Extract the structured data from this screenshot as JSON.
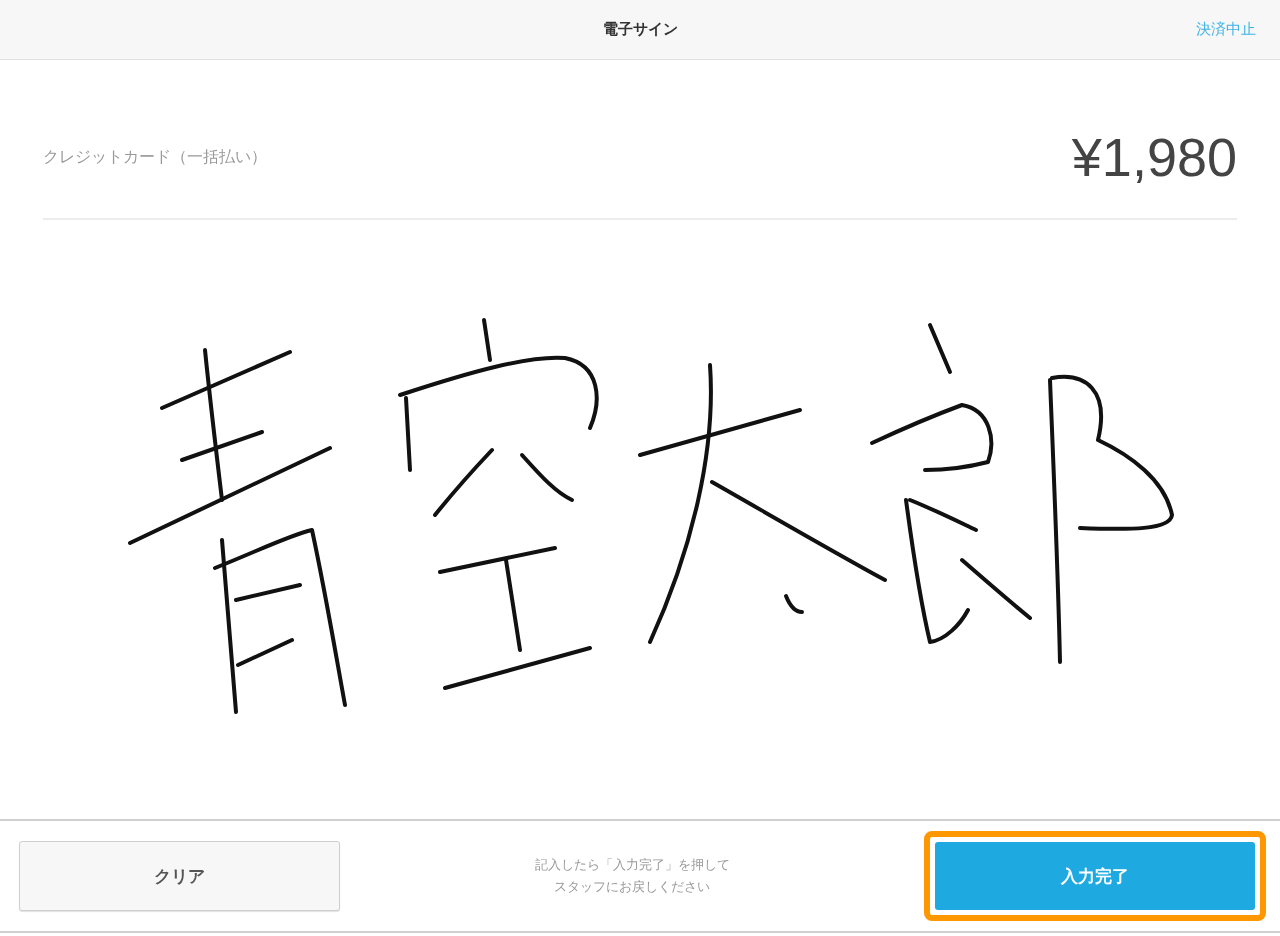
{
  "header": {
    "title": "電子サイン",
    "cancel_link": "決済中止"
  },
  "payment": {
    "method": "クレジットカード（一括払い）",
    "amount": "¥1,980"
  },
  "signature_pad": {
    "signed": true
  },
  "footer": {
    "clear_button": "クリア",
    "hint": "記入したら「入力完了」を押してスタッフにお戻しください",
    "done_button": {
      "label": "入力完了",
      "highlighted": true
    }
  }
}
